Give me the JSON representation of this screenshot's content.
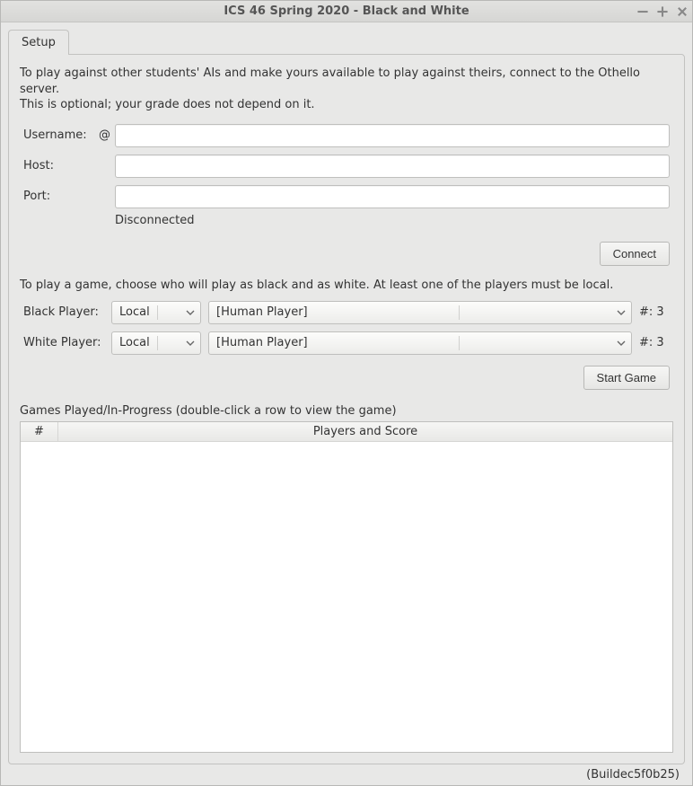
{
  "window": {
    "title": "ICS 46 Spring 2020 - Black and White"
  },
  "tabs": {
    "setup": "Setup"
  },
  "intro": {
    "line1": "To play against other students' AIs and make yours available to play against theirs, connect to the Othello server.",
    "line2": "This is optional; your grade does not depend on it."
  },
  "connection": {
    "username_label": "Username:",
    "username_prefix": "@",
    "username_value": "",
    "host_label": "Host:",
    "host_value": "",
    "port_label": "Port:",
    "port_value": "",
    "status": "Disconnected",
    "connect_button": "Connect"
  },
  "play_instructions": "To play a game, choose who will play as black and as white.  At least one of the players must be local.",
  "black": {
    "label": "Black Player:",
    "scope": "Local",
    "player": "[Human Player]",
    "hash_label": "#:",
    "hash_value": "3"
  },
  "white": {
    "label": "White Player:",
    "scope": "Local",
    "player": "[Human Player]",
    "hash_label": "#:",
    "hash_value": "3"
  },
  "start_button": "Start Game",
  "games": {
    "label": "Games Played/In-Progress (double-click a row to view the game)",
    "col_num": "#",
    "col_players": "Players and Score",
    "rows": []
  },
  "build": {
    "prefix": "(Build ",
    "id": "ec5f0b25",
    "suffix": ")"
  }
}
